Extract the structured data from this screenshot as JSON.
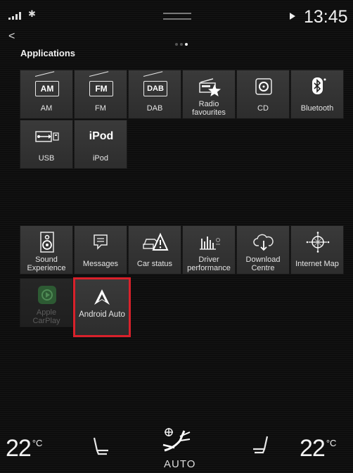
{
  "status_bar": {
    "time": "13:45",
    "bluetooth_symbol": "✱"
  },
  "nav": {
    "back_symbol": "<",
    "page_count": 3,
    "active_page": 3
  },
  "section_title": "Applications",
  "apps_row1": [
    {
      "id": "am",
      "label": "AM",
      "icon": "am-radio-icon",
      "icon_text": "AM"
    },
    {
      "id": "fm",
      "label": "FM",
      "icon": "fm-radio-icon",
      "icon_text": "FM"
    },
    {
      "id": "dab",
      "label": "DAB",
      "icon": "dab-radio-icon",
      "icon_text": "DAB"
    },
    {
      "id": "radio-favourites",
      "label": "Radio favourites",
      "icon": "radio-star-icon"
    },
    {
      "id": "cd",
      "label": "CD",
      "icon": "cd-icon"
    },
    {
      "id": "bluetooth",
      "label": "Bluetooth",
      "icon": "bluetooth-icon"
    }
  ],
  "apps_row2": [
    {
      "id": "usb",
      "label": "USB",
      "icon": "usb-icon"
    },
    {
      "id": "ipod",
      "label": "iPod",
      "icon": "ipod-icon",
      "icon_text": "iPod"
    }
  ],
  "apps_row3": [
    {
      "id": "sound-experience",
      "label": "Sound Experience",
      "icon": "speaker-icon"
    },
    {
      "id": "messages",
      "label": "Messages",
      "icon": "message-icon"
    },
    {
      "id": "car-status",
      "label": "Car status",
      "icon": "car-warning-icon"
    },
    {
      "id": "driver-performance",
      "label": "Driver performance",
      "icon": "bar-graph-icon"
    },
    {
      "id": "download-centre",
      "label": "Download Centre",
      "icon": "cloud-download-icon"
    },
    {
      "id": "internet-map",
      "label": "Internet Map",
      "icon": "compass-icon"
    }
  ],
  "apps_row4": [
    {
      "id": "apple-carplay",
      "label": "Apple CarPlay",
      "icon": "carplay-icon",
      "disabled": true
    },
    {
      "id": "android-auto",
      "label": "Android Auto",
      "icon": "android-auto-icon",
      "selected": true
    }
  ],
  "climate": {
    "left_temp": "22",
    "right_temp": "22",
    "unit": "°C",
    "mode_label": "AUTO"
  },
  "colors": {
    "selection_border": "#d9212b",
    "tile": "#353535",
    "background": "#0d0d0d"
  }
}
